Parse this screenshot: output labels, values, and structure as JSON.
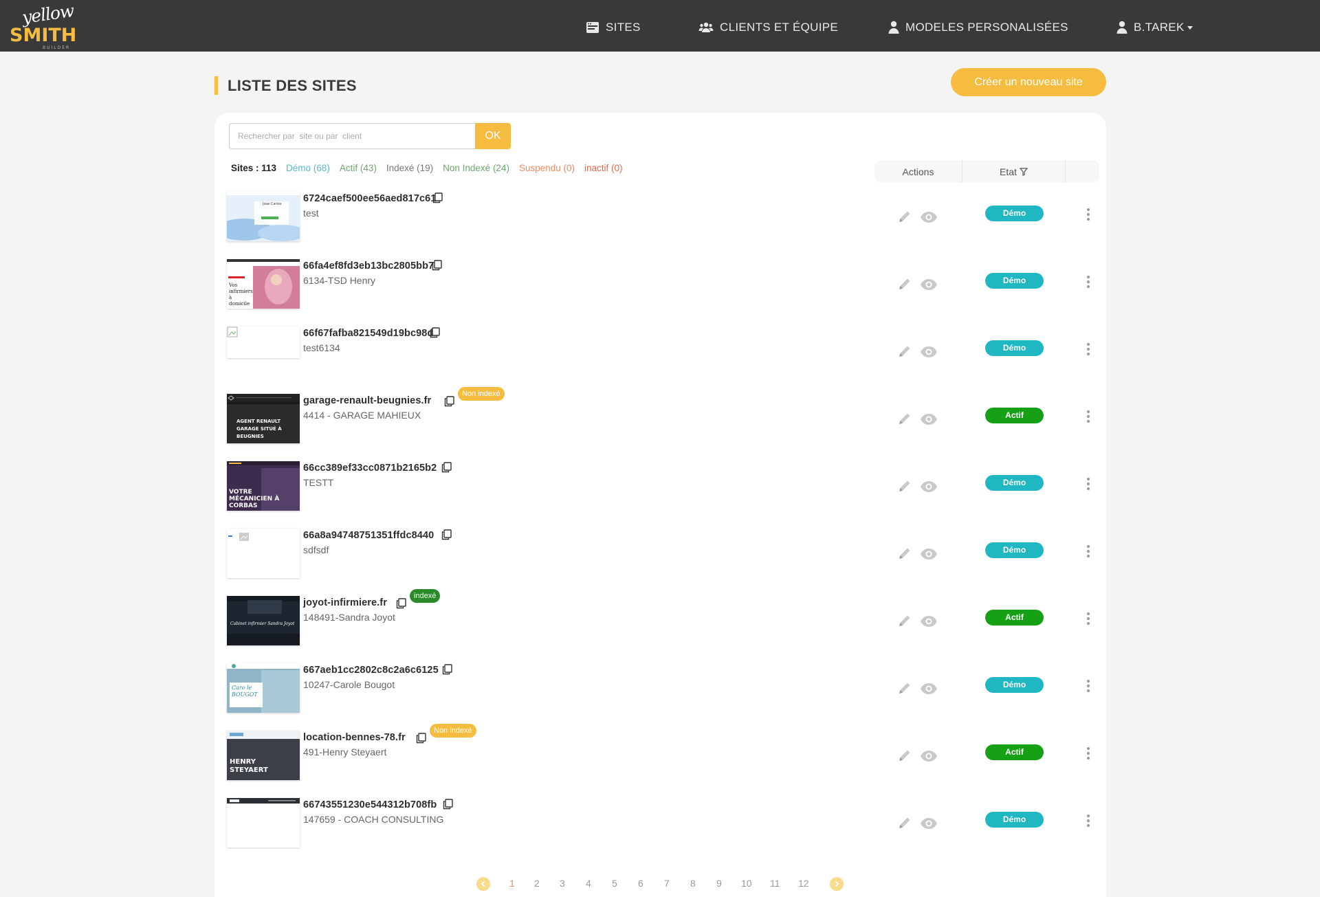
{
  "nav": {
    "logo_script": "yellow",
    "logo_main": "SMITH",
    "logo_sub": "BUILDER",
    "sites": "SITES",
    "clients": "CLIENTS ET ÉQUIPE",
    "modeles": "MODELES PERSONALISÉES",
    "user": "B.TAREK"
  },
  "header": {
    "title": "LISTE DES SITES",
    "create_button": "Créer un nouveau site"
  },
  "search": {
    "placeholder": "Rechercher par  site ou par  client",
    "ok_label": "OK"
  },
  "filters": {
    "total": "Sites : 113",
    "demo": "Démo (68)",
    "actif": "Actif (43)",
    "indexe": "Indexé (19)",
    "non_indexe": "Non Indexé (24)",
    "suspendu": "Suspendu (0)",
    "inactif": "inactif (0)"
  },
  "table_headers": {
    "actions": "Actions",
    "etat": "Etat"
  },
  "rows": [
    {
      "name": "6724caef500ee56aed817c61",
      "client": "test",
      "status": "Démo",
      "index_badge": ""
    },
    {
      "name": "66fa4ef8fd3eb13bc2805bb7",
      "client": "6134-TSD Henry",
      "status": "Démo",
      "index_badge": ""
    },
    {
      "name": "66f67fafba821549d19bc98d",
      "client": "test6134",
      "status": "Démo",
      "index_badge": ""
    },
    {
      "name": "garage-renault-beugnies.fr",
      "client": "4414 - GARAGE MAHIEUX",
      "status": "Actif",
      "index_badge": "Non indexé"
    },
    {
      "name": "66cc389ef33cc0871b2165b2",
      "client": "TESTT",
      "status": "Démo",
      "index_badge": ""
    },
    {
      "name": "66a8a94748751351ffdc8440",
      "client": "sdfsdf",
      "status": "Démo",
      "index_badge": ""
    },
    {
      "name": "joyot-infirmiere.fr",
      "client": "148491-Sandra Joyot",
      "status": "Actif",
      "index_badge": "indexé"
    },
    {
      "name": "667aeb1cc2802c8c2a6c6125",
      "client": "10247-Carole Bougot",
      "status": "Démo",
      "index_badge": ""
    },
    {
      "name": "location-bennes-78.fr",
      "client": "491-Henry Steyaert",
      "status": "Actif",
      "index_badge": "Non indexé"
    },
    {
      "name": "66743551230e544312b708fb",
      "client": "147659 - COACH CONSULTING",
      "status": "Démo",
      "index_badge": ""
    }
  ],
  "thumbnails": {
    "t1": "Jose Carlos",
    "t2": "Vos infirmiers à domicile",
    "t4": "AGENT RENAULT GARAGE SITUÉ À BEUGNIES",
    "t5": "VOTRE MÉCANICIEN À CORBAS",
    "t7": "Cabinet infirmier Sandra Joyot",
    "t8": "Caro le BOUGOT",
    "t9": "HENRY STEYAERT"
  },
  "pagination": {
    "pages": [
      "1",
      "2",
      "3",
      "4",
      "5",
      "6",
      "7",
      "8",
      "9",
      "10",
      "11",
      "12"
    ],
    "active": "1"
  },
  "colors": {
    "brand": "#f5bc40",
    "navbar": "#393939",
    "demo": "#1fb8c2",
    "actif": "#16a016"
  }
}
